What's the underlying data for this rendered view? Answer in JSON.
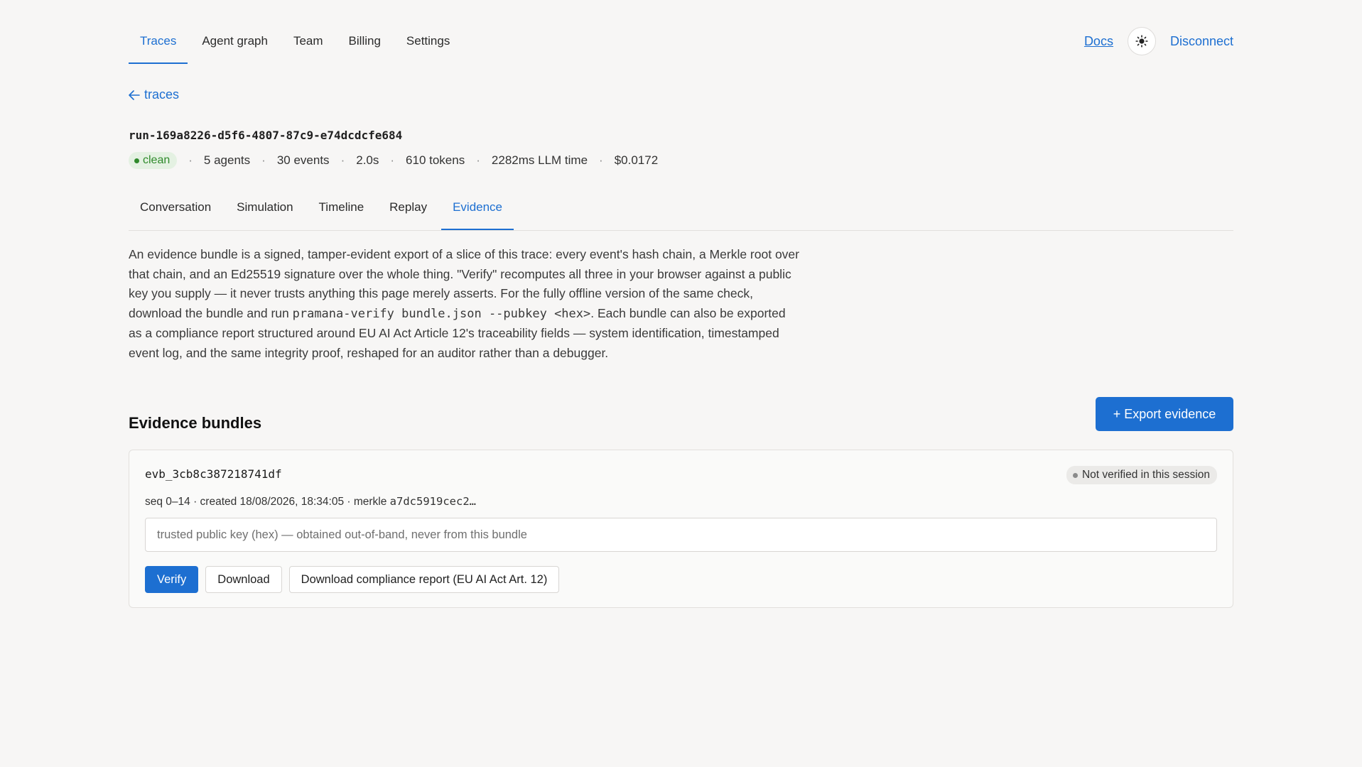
{
  "nav": {
    "tabs": [
      {
        "label": "Traces"
      },
      {
        "label": "Agent graph"
      },
      {
        "label": "Team"
      },
      {
        "label": "Billing"
      },
      {
        "label": "Settings"
      }
    ],
    "active_tab": "Traces",
    "docs_label": "Docs",
    "theme_icon": "sun-icon",
    "disconnect_label": "Disconnect"
  },
  "back_link": {
    "label": "traces"
  },
  "run": {
    "id": "run-169a8226-d5f6-4807-87c9-e74dcdcfe684",
    "status": "clean",
    "agents": "5 agents",
    "events": "30 events",
    "duration": "2.0s",
    "tokens": "610 tokens",
    "llm_time": "2282ms LLM time",
    "cost": "$0.0172"
  },
  "subtabs": [
    {
      "label": "Conversation"
    },
    {
      "label": "Simulation"
    },
    {
      "label": "Timeline"
    },
    {
      "label": "Replay"
    },
    {
      "label": "Evidence"
    }
  ],
  "active_subtab": "Evidence",
  "description": {
    "part1": "An evidence bundle is a signed, tamper-evident export of a slice of this trace: every event's hash chain, a Merkle root over that chain, and an Ed25519 signature over the whole thing. \"Verify\" recomputes all three in your browser against a public key you supply — it never trusts anything this page merely asserts. For the fully offline version of the same check, download the bundle and run ",
    "code1": "pramana-verify bundle.json --pubkey <hex>",
    "part2": ". Each bundle can also be exported as a compliance report structured around EU AI Act Article 12's traceability fields — system identification, timestamped event log, and the same integrity proof, reshaped for an auditor rather than a debugger."
  },
  "bundles": {
    "title": "Evidence bundles",
    "export_label": "+ Export evidence",
    "items": [
      {
        "id": "evb_3cb8c387218741df",
        "status": "Not verified in this session",
        "info_prefix": "seq 0–14 · created 18/08/2026, 18:34:05 · merkle ",
        "merkle": "a7dc5919cec2…",
        "key_placeholder": "trusted public key (hex) — obtained out-of-band, never from this bundle",
        "verify_label": "Verify",
        "download_label": "Download",
        "report_label": "Download compliance report (EU AI Act Art. 12)"
      }
    ]
  },
  "colors": {
    "accent": "#1d6fd1",
    "clean_green": "#2f8a2b",
    "background": "#f7f6f5"
  }
}
